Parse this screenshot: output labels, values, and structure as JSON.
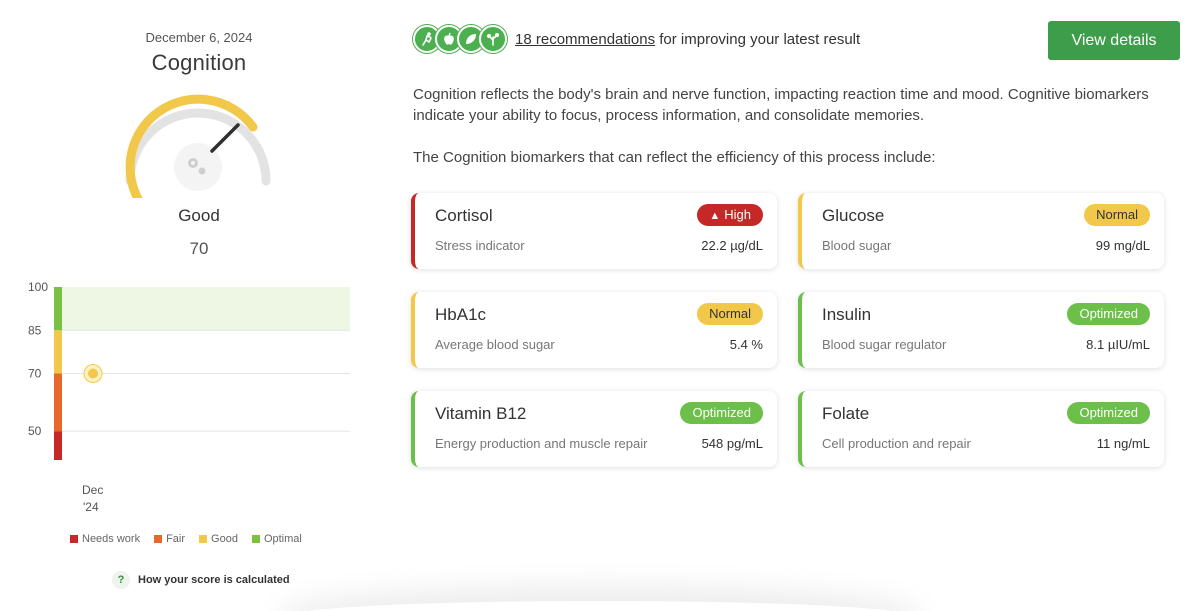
{
  "header": {
    "date": "December 6, 2024",
    "title": "Cognition"
  },
  "gauge": {
    "status": "Good",
    "score": 70,
    "score_text": "70",
    "max": 100,
    "fill_color": "#f2c84b",
    "track_color": "#e3e3e3",
    "icon": "gears-icon"
  },
  "chart_data": {
    "type": "scatter",
    "y_ticks": [
      "100",
      "85",
      "70",
      "50"
    ],
    "ylim": [
      40,
      100
    ],
    "bands": [
      {
        "name": "Needs work",
        "from": 40,
        "to": 50,
        "color": "#c62828"
      },
      {
        "name": "Fair",
        "from": 50,
        "to": 70,
        "color": "#e8672b"
      },
      {
        "name": "Good",
        "from": 70,
        "to": 85,
        "color": "#f2c84b"
      },
      {
        "name": "Optimal",
        "from": 85,
        "to": 100,
        "color": "#7bc043"
      }
    ],
    "optimal_zone": {
      "from": 85,
      "to": 100,
      "color": "#eef7e4"
    },
    "points": [
      {
        "x": "Dec '24",
        "y": 70
      }
    ],
    "x_labels": [
      {
        "line1": "Dec",
        "line2": "'24"
      }
    ]
  },
  "legend": [
    {
      "label": "Needs work",
      "color": "#c62828"
    },
    {
      "label": "Fair",
      "color": "#e8672b"
    },
    {
      "label": "Good",
      "color": "#f2c84b"
    },
    {
      "label": "Optimal",
      "color": "#7bc043"
    }
  ],
  "help": {
    "icon_text": "?",
    "label": "How your score is calculated"
  },
  "recommendations": {
    "icons": [
      "running-icon",
      "apple-icon",
      "leaf-icon",
      "herb-icon"
    ],
    "link_text": "18 recommendations",
    "suffix": " for improving your latest result",
    "button": "View details"
  },
  "description": {
    "paragraph1": "Cognition reflects the body's brain and nerve function, impacting reaction time and mood. Cognitive biomarkers indicate your ability to focus, process information, and consolidate memories.",
    "paragraph2": "The Cognition biomarkers that can reflect the efficiency of this process include:"
  },
  "colors": {
    "high": "#c62828",
    "normal": "#f2c84b",
    "optimized": "#6cc04a",
    "button": "#3e9d4a"
  },
  "biomarkers": [
    {
      "name": "Cortisol",
      "subtitle": "Stress indicator",
      "value": "22.2 µg/dL",
      "status": "High",
      "status_type": "high"
    },
    {
      "name": "Glucose",
      "subtitle": "Blood sugar",
      "value": "99 mg/dL",
      "status": "Normal",
      "status_type": "normal"
    },
    {
      "name": "HbA1c",
      "subtitle": "Average blood sugar",
      "value": "5.4 %",
      "status": "Normal",
      "status_type": "normal"
    },
    {
      "name": "Insulin",
      "subtitle": "Blood sugar regulator",
      "value": "8.1 µIU/mL",
      "status": "Optimized",
      "status_type": "optimized"
    },
    {
      "name": "Vitamin B12",
      "subtitle": "Energy production and muscle repair",
      "value": "548 pg/mL",
      "status": "Optimized",
      "status_type": "optimized"
    },
    {
      "name": "Folate",
      "subtitle": "Cell production and repair",
      "value": "11 ng/mL",
      "status": "Optimized",
      "status_type": "optimized"
    }
  ]
}
